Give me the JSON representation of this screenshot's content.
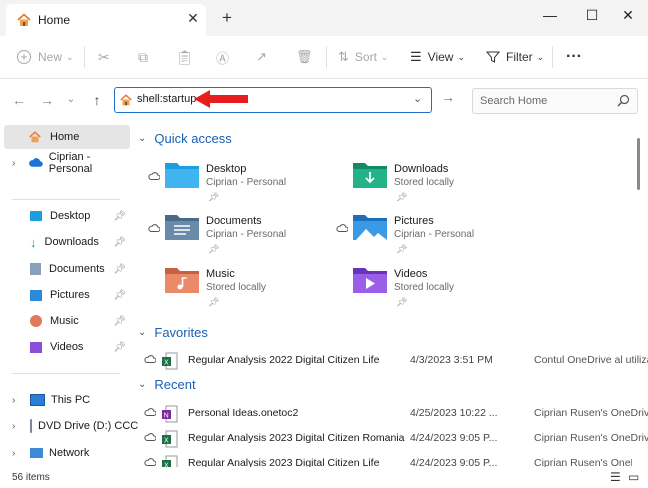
{
  "window": {
    "tab_title": "Home"
  },
  "toolbar": {
    "new_label": "New",
    "sort_label": "Sort",
    "view_label": "View",
    "filter_label": "Filter"
  },
  "address": {
    "path": "shell:startup"
  },
  "search": {
    "placeholder": "Search Home"
  },
  "sidebar": {
    "items": [
      {
        "label": "Home"
      },
      {
        "label": "Ciprian - Personal"
      },
      {
        "label": "Desktop"
      },
      {
        "label": "Downloads"
      },
      {
        "label": "Documents"
      },
      {
        "label": "Pictures"
      },
      {
        "label": "Music"
      },
      {
        "label": "Videos"
      },
      {
        "label": "This PC"
      },
      {
        "label": "DVD Drive (D:) CCC"
      },
      {
        "label": "Network"
      }
    ]
  },
  "quick_access": {
    "heading": "Quick access",
    "items": [
      {
        "name": "Desktop",
        "sub": "Ciprian - Personal",
        "color": "#1e9de0"
      },
      {
        "name": "Downloads",
        "sub": "Stored locally",
        "color": "#1aa37a"
      },
      {
        "name": "Documents",
        "sub": "Ciprian - Personal",
        "color": "#5a7a9a"
      },
      {
        "name": "Pictures",
        "sub": "Ciprian - Personal",
        "color": "#2c8ad6"
      },
      {
        "name": "Music",
        "sub": "Stored locally",
        "color": "#e07a5a"
      },
      {
        "name": "Videos",
        "sub": "Stored locally",
        "color": "#8a4fd8"
      }
    ]
  },
  "favorites": {
    "heading": "Favorites",
    "rows": [
      {
        "name": "Regular Analysis 2022 Digital Citizen Life",
        "date": "4/3/2023 3:51 PM",
        "location": "Contul OneDrive al utilizat..."
      }
    ]
  },
  "recent": {
    "heading": "Recent",
    "rows": [
      {
        "name": "Personal Ideas.onetoc2",
        "date": "4/25/2023 10:22 ...",
        "location": "Ciprian Rusen's OneDrive"
      },
      {
        "name": "Regular Analysis 2023 Digital Citizen Romania",
        "date": "4/24/2023 9:05 P...",
        "location": "Ciprian Rusen's OneDrive"
      },
      {
        "name": "Regular Analysis 2023 Digital Citizen Life",
        "date": "4/24/2023 9:05 P...",
        "location": "Ciprian Rusen's OneDrive"
      }
    ]
  },
  "status": {
    "item_count": "56 items"
  }
}
